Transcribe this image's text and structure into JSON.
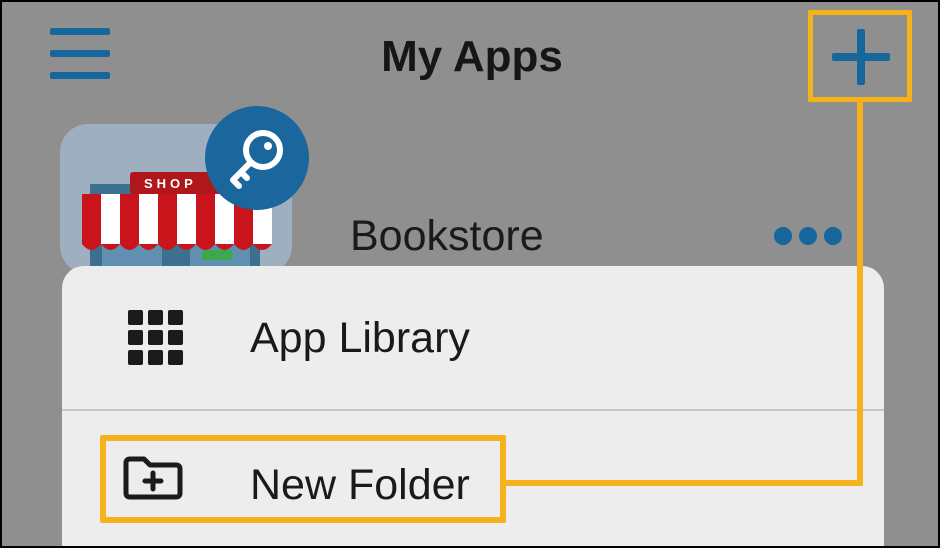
{
  "header": {
    "title": "My Apps",
    "menu_icon": "hamburger-menu-icon",
    "add_icon": "plus-icon"
  },
  "app": {
    "name": "Bookstore",
    "icon_label": "SHOP",
    "badge_icon": "key-icon",
    "more_icon": "more-dots-icon"
  },
  "sheet": {
    "items": [
      {
        "label": "App Library",
        "icon": "grid-icon"
      },
      {
        "label": "New Folder",
        "icon": "new-folder-icon"
      }
    ]
  },
  "colors": {
    "accent_blue": "#17679d",
    "highlight_yellow": "#f6b21a",
    "dim_background": "#8f8f8f",
    "sheet_background": "#ededed"
  }
}
